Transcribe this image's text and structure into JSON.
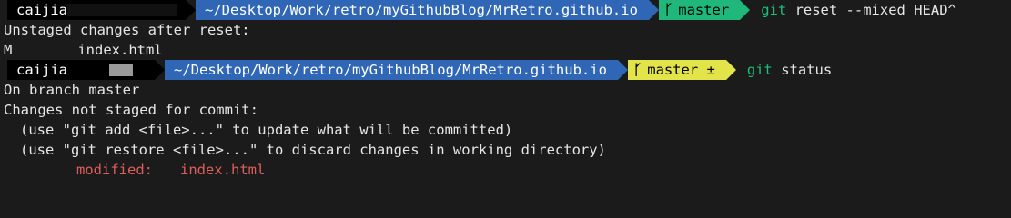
{
  "prompt1": {
    "user": "caijia",
    "path": "~/Desktop/Work/retro/myGithubBlog/MrRetro.github.io",
    "branch_icon": "ᚴ",
    "branch": "master",
    "git_word": "git",
    "command_rest": " reset --mixed HEAD^"
  },
  "output1": {
    "line1": "Unstaged changes after reset:",
    "status_flag": "M",
    "file": "index.html"
  },
  "prompt2": {
    "user": "caijia",
    "path": "~/Desktop/Work/retro/myGithubBlog/MrRetro.github.io",
    "branch_icon": "ᚴ",
    "branch": "master ±",
    "git_word": "git",
    "command_rest": " status"
  },
  "output2": {
    "line1": "On branch master",
    "line2": "Changes not staged for commit:",
    "hint1": "(use \"git add <file>...\" to update what will be committed)",
    "hint2": "(use \"git restore <file>...\" to discard changes in working directory)",
    "modified_label": "modified:",
    "modified_file": "index.html"
  },
  "colors": {
    "path_segment": "#2f66b6",
    "branch_clean": "#1fb77a",
    "branch_dirty": "#e3e44a",
    "git_word": "#17c07b",
    "modified": "#e05c5c"
  }
}
